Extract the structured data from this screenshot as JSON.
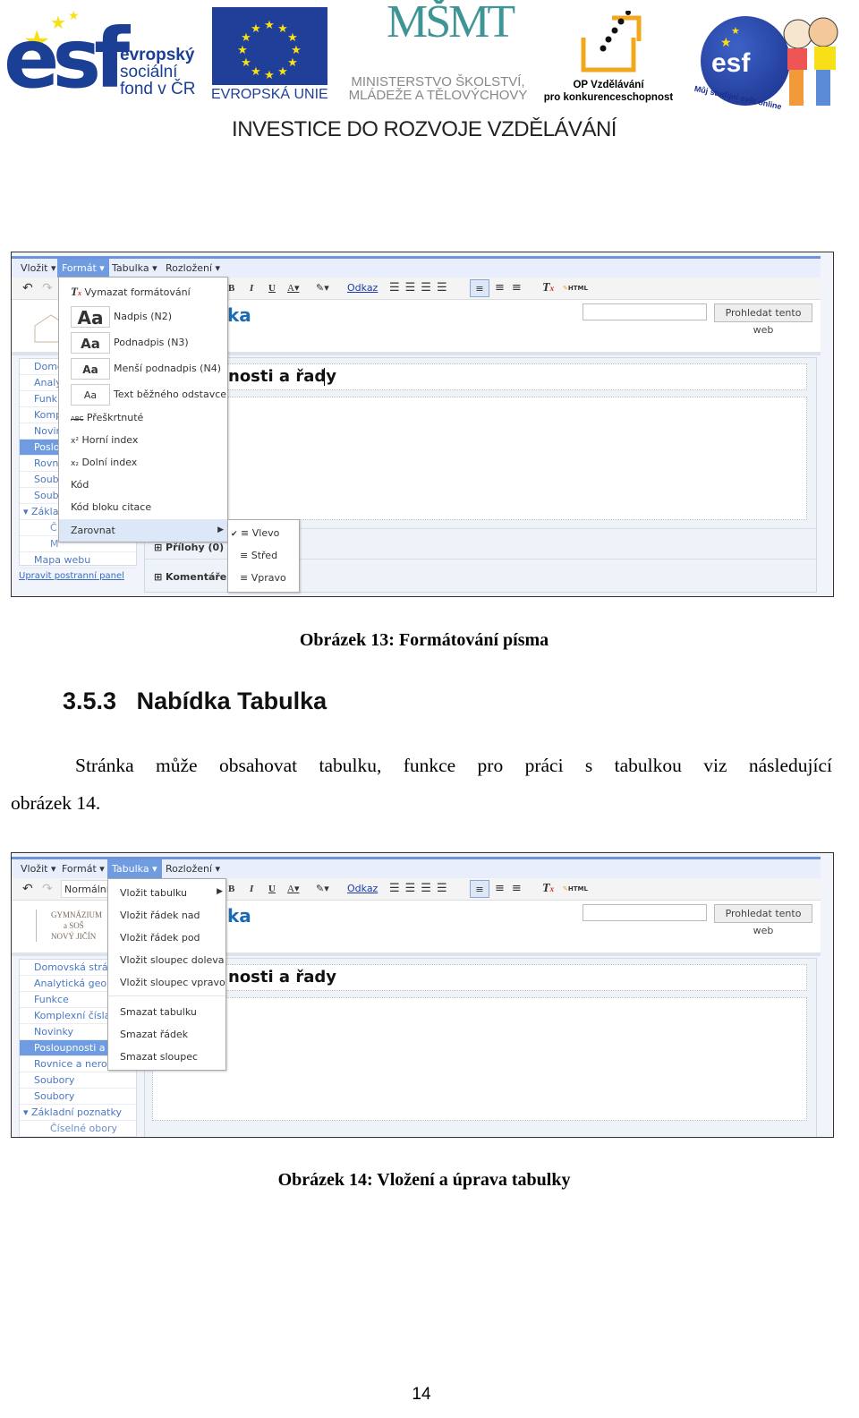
{
  "header": {
    "esf_logo": {
      "word": "esf",
      "lines": [
        "evropský",
        "sociální",
        "fond v ČR"
      ]
    },
    "eu_logo": {
      "caption": "EVROPSKÁ UNIE"
    },
    "msmt_logo": {
      "mark": "MŠMT",
      "lines": [
        "MINISTERSTVO ŠKOLSTVÍ,",
        "MLÁDEŽE A TĚLOVÝCHOVY"
      ]
    },
    "op_logo": {
      "lines": [
        "OP Vzdělávání",
        "pro konkurenceschopnost"
      ]
    },
    "esf_online_logo": {
      "word": "esf",
      "slogan": "Můj studijní svět online"
    },
    "tagline": "INVESTICE DO ROZVOJE  VZDĚLÁVÁNÍ"
  },
  "editor": {
    "menubar": [
      "Vložit ▾",
      "Formát ▾",
      "Tabulka ▾",
      "Rozložení ▾"
    ],
    "toolbar": {
      "bold": "B",
      "italic": "I",
      "underline": "U",
      "text_color": "A▾",
      "highlight": "✎▾",
      "link": "Odkaz",
      "html": "HTML",
      "style_select": "Normální"
    },
    "search_button": "Prohledat tento web",
    "site_title_fragment": "ka",
    "school_logo": [
      "GYMNÁZIUM",
      "a SOŠ",
      "NOVÝ JIČÍN"
    ],
    "page_title_fragment_1": "nosti a řady",
    "page_title_fragment_2": "osti a řady",
    "attachments": "Přílohy (0)",
    "comments": "Komentáře (0",
    "edit_sidebar_link": "Upravit postranní panel",
    "sidebar_1": [
      "Domo",
      "Analy",
      "Funk",
      "Komp",
      "Novin",
      "Poslo",
      "Rovni",
      "Soub",
      "Soub",
      "▾ Zákla",
      "Č",
      "M",
      "Mapa webu"
    ],
    "sidebar_2": [
      "Domovská strán",
      "Analytická geom",
      "Funkce",
      "Komplexní čísla",
      "Novinky",
      "Posloupnosti a ř",
      "Rovnice a nerov",
      "Soubory",
      "Soubory",
      "▾ Základní poznatky",
      "Číselné obory"
    ],
    "format_menu": [
      {
        "label": "Vymazat formátování",
        "icon": "clear-format-icon"
      },
      {
        "label": "Nadpis (N2)",
        "preview": "Aa"
      },
      {
        "label": "Podnadpis (N3)",
        "preview": "Aa"
      },
      {
        "label": "Menší podnadpis (N4)",
        "preview": "Aa"
      },
      {
        "label": "Text běžného odstavce",
        "preview": "Aa"
      },
      {
        "label": "Přeškrtnuté",
        "icon": "ABC"
      },
      {
        "label": "Horní index",
        "icon": "x²"
      },
      {
        "label": "Dolní index",
        "icon": "x₂"
      },
      {
        "label": "Kód"
      },
      {
        "label": "Kód bloku citace"
      },
      {
        "label": "Zarovnat",
        "submenu": true
      }
    ],
    "align_submenu": [
      {
        "label": "Vlevo",
        "checked": true
      },
      {
        "label": "Střed",
        "checked": false
      },
      {
        "label": "Vpravo",
        "checked": false
      }
    ],
    "table_menu": [
      "Vložit tabulku",
      "Vložit řádek nad",
      "Vložit řádek pod",
      "Vložit sloupec doleva",
      "Vložit sloupec vpravo",
      "Smazat tabulku",
      "Smazat řádek",
      "Smazat sloupec"
    ],
    "accent_color": "#6f9ce0"
  },
  "doc": {
    "caption_13": "Obrázek 13: Formátování písma",
    "heading_number": "3.5.3",
    "heading_title": "Nabídka Tabulka",
    "paragraph_line1": "Stránka může obsahovat tabulku, funkce pro práci s tabulkou viz následující",
    "paragraph_line2": "obrázek 14.",
    "caption_14": "Obrázek 14: Vložení a úprava tabulky",
    "page_number": "14"
  }
}
